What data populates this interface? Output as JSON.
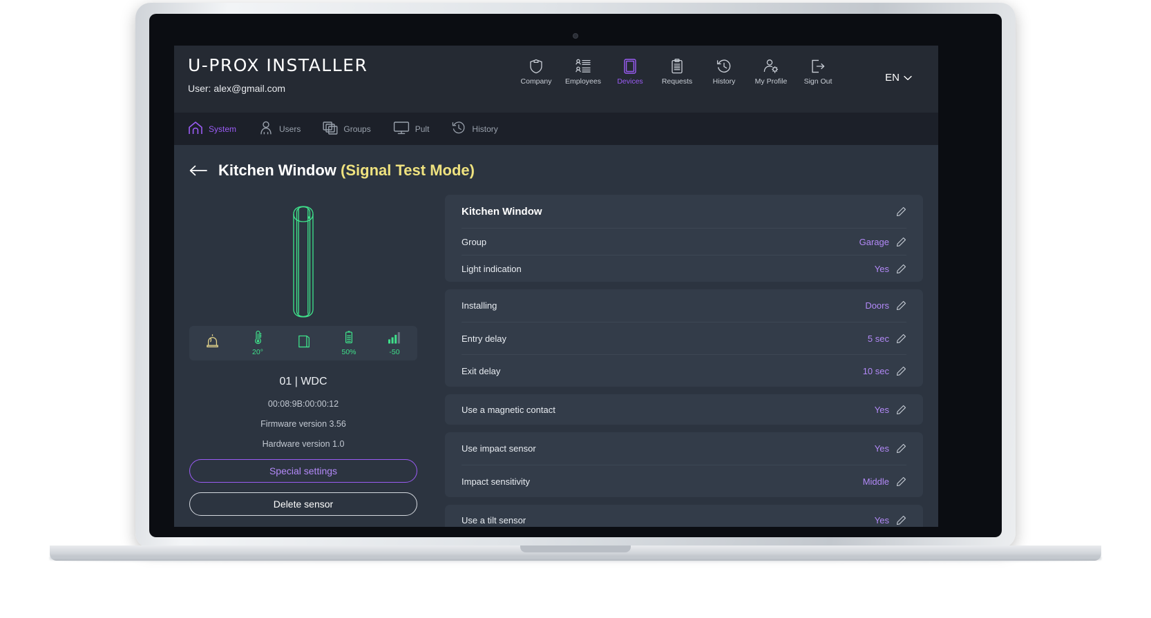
{
  "header": {
    "logo": "U-PROX INSTALLER",
    "user": "User: alex@gmail.com",
    "lang": "EN",
    "nav": [
      {
        "label": "Company",
        "icon": "shield-icon",
        "active": false
      },
      {
        "label": "Employees",
        "icon": "employees-icon",
        "active": false
      },
      {
        "label": "Devices",
        "icon": "tablet-icon",
        "active": true
      },
      {
        "label": "Requests",
        "icon": "clipboard-icon",
        "active": false
      },
      {
        "label": "History",
        "icon": "clock-back-icon",
        "active": false
      },
      {
        "label": "My Profile",
        "icon": "profile-gear-icon",
        "active": false
      },
      {
        "label": "Sign Out",
        "icon": "sign-out-icon",
        "active": false
      }
    ]
  },
  "subnav": [
    {
      "label": "System",
      "icon": "home-icon",
      "active": true
    },
    {
      "label": "Users",
      "icon": "user-icon",
      "active": false
    },
    {
      "label": "Groups",
      "icon": "groups-icon",
      "active": false
    },
    {
      "label": "Pult",
      "icon": "monitor-icon",
      "active": false
    },
    {
      "label": "History",
      "icon": "clock-back-icon",
      "active": false
    }
  ],
  "page": {
    "back_icon": "back-arrow-icon",
    "title": "Kitchen Window",
    "mode": "(Signal Test Mode)"
  },
  "device": {
    "render_icon": "window-sensor-3d",
    "status": [
      {
        "icon": "siren-icon",
        "value": "",
        "color": "yellow"
      },
      {
        "icon": "thermometer-icon",
        "value": "20°",
        "color": "green"
      },
      {
        "icon": "window-icon",
        "value": "",
        "color": "green"
      },
      {
        "icon": "battery-icon",
        "value": "50%",
        "color": "green"
      },
      {
        "icon": "signal-icon",
        "value": "-50",
        "color": "green"
      }
    ],
    "name": "01 | WDC",
    "mac": "00:08:9B:00:00:12",
    "firmware": "Firmware version 3.56",
    "hardware": "Hardware version 1.0",
    "special_settings_label": "Special settings",
    "delete_sensor_label": "Delete sensor"
  },
  "settings": {
    "card_title": "Kitchen Window",
    "groups": [
      {
        "rows": [
          {
            "label": "Group",
            "value": "Garage"
          },
          {
            "label": "Light indication",
            "value": "Yes"
          }
        ]
      },
      {
        "rows": [
          {
            "label": "Installing",
            "value": "Doors"
          },
          {
            "label": "Entry delay",
            "value": "5 sec"
          },
          {
            "label": "Exit delay",
            "value": "10 sec"
          }
        ]
      },
      {
        "rows": [
          {
            "label": "Use a magnetic contact",
            "value": "Yes"
          }
        ]
      },
      {
        "rows": [
          {
            "label": "Use impact sensor",
            "value": "Yes"
          },
          {
            "label": "Impact sensitivity",
            "value": "Middle"
          }
        ]
      },
      {
        "rows": [
          {
            "label": "Use a tilt sensor",
            "value": "Yes"
          }
        ]
      }
    ]
  },
  "colors": {
    "accent": "#9b5cf6",
    "accent_light": "#b389f8",
    "mode_yellow": "#efe27f",
    "green": "#3fe08a",
    "header_bg": "#252a33",
    "subnav_bg": "#1c2029",
    "body_bg": "#2c3440",
    "card_bg": "#333c49"
  }
}
